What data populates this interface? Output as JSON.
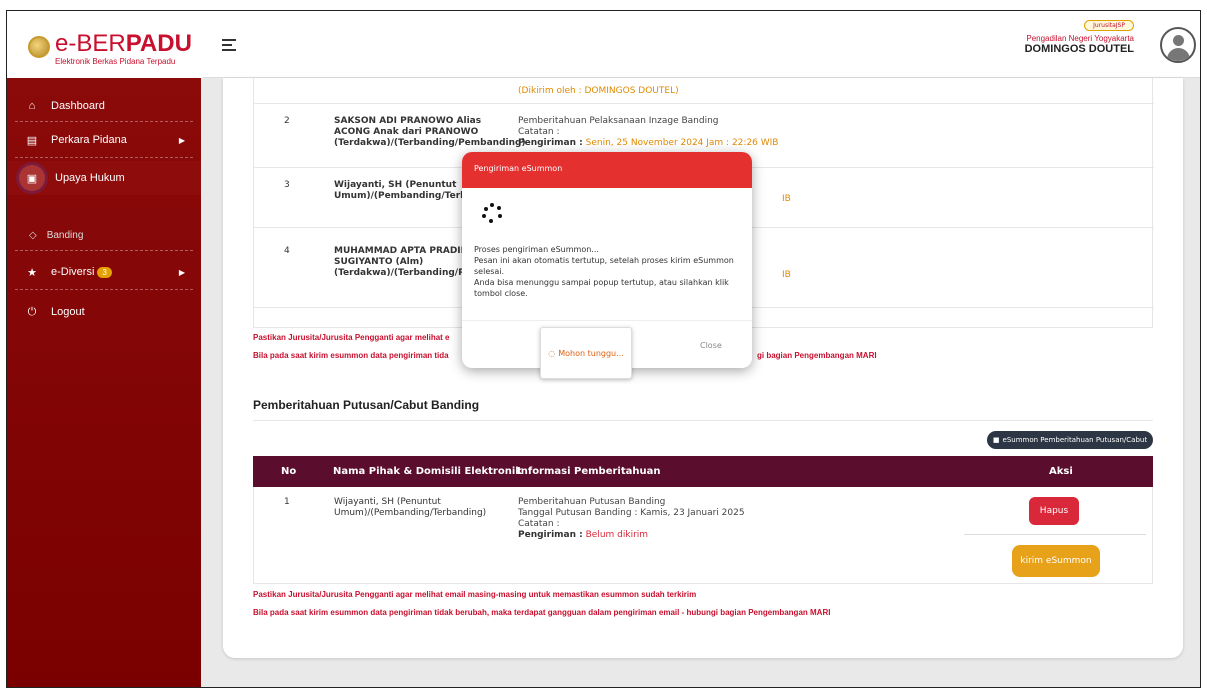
{
  "brand": {
    "title_pre": "e-",
    "title_mid": "BER",
    "title_bold": "PADU",
    "subtitle": "Elektronik Berkas Pidana Terpadu"
  },
  "user": {
    "role": "JurusitaJSP",
    "court": "Pengadilan Negeri Yogyakarta",
    "name": "DOMINGOS DOUTEL"
  },
  "sidebar": {
    "items": [
      {
        "label": "Dashboard",
        "icon": "home-icon"
      },
      {
        "label": "Perkara Pidana",
        "icon": "folder-icon"
      },
      {
        "label": "Upaya Hukum",
        "icon": "document-icon"
      },
      {
        "label": "Banding",
        "icon": "circle-icon"
      },
      {
        "label": "e-Diversi",
        "icon": "star-icon",
        "badge": "3"
      },
      {
        "label": "Logout",
        "icon": "power-icon"
      }
    ]
  },
  "top_table": {
    "row1_note": "(Dikirim oleh : DOMINGOS DOUTEL)",
    "rows": [
      {
        "no": "2",
        "name": "SAKSON ADI PRANOWO Alias ACONG Anak dari PRANOWO (Terdakwa)/(Terbanding/Pembanding)",
        "info_title": "Pemberitahuan Pelaksanaan Inzage Banding",
        "catatan": "Catatan :",
        "pengiriman_label": "Pengiriman :",
        "pengiriman_value": "Senin, 25 November 2024 Jam : 22:26 WIB"
      },
      {
        "no": "3",
        "name": "Wijayanti, SH (Penuntut Umum)/(Pembanding/Terbar",
        "tail": "IB"
      },
      {
        "no": "4",
        "name": "MUHAMMAD APTA PRADIPTA SUGIYANTO (Alm) (Terdakwa)/(Terbanding/Pem",
        "tail": "IB"
      }
    ]
  },
  "warnings": {
    "w1": "Pastikan Jurusita/Jurusita Pengganti agar melihat email masing-masing untuk memastikan esummon sudah terkirim",
    "w2": "Bila pada saat kirim esummon data pengiriman tidak berubah, maka terdapat gangguan dalam pengiriman email - hubungi bagian Pengembangan MARI",
    "w1_short": "Pastikan Jurusita/Jurusita Pengganti agar melihat e",
    "w2_short": "Bila pada saat kirim esummon data pengiriman tida",
    "w2_tail": "gi bagian Pengembangan MARI"
  },
  "section2": {
    "title": "Pemberitahuan Putusan/Cabut Banding",
    "esummon_button": "eSummon Pemberitahuan Putusan/Cabut",
    "headers": {
      "no": "No",
      "nama": "Nama Pihak & Domisili Elektronik",
      "info": "Informasi Pemberitahuan",
      "aksi": "Aksi"
    },
    "row": {
      "no": "1",
      "name": "Wijayanti, SH (Penuntut Umum)/(Pembanding/Terbanding)",
      "info_title": "Pemberitahuan Putusan Banding",
      "tanggal": "Tanggal Putusan Banding : Kamis, 23 Januari 2025",
      "catatan": "Catatan :",
      "pengiriman_label": "Pengiriman :",
      "pengiriman_value": "Belum dikirim",
      "hapus": "Hapus",
      "kirim": "kirim eSummon"
    }
  },
  "modal": {
    "title": "Pengiriman eSummon",
    "line1": "Proses pengiriman eSummon...",
    "line2": "Pesan ini akan otomatis tertutup, setelah proses kirim eSummon selesai.",
    "line3": "Anda bisa menunggu sampai popup tertutup, atau silahkan klik tombol close.",
    "wait_button": "Mohon tunggu...",
    "close_button": "Close"
  }
}
